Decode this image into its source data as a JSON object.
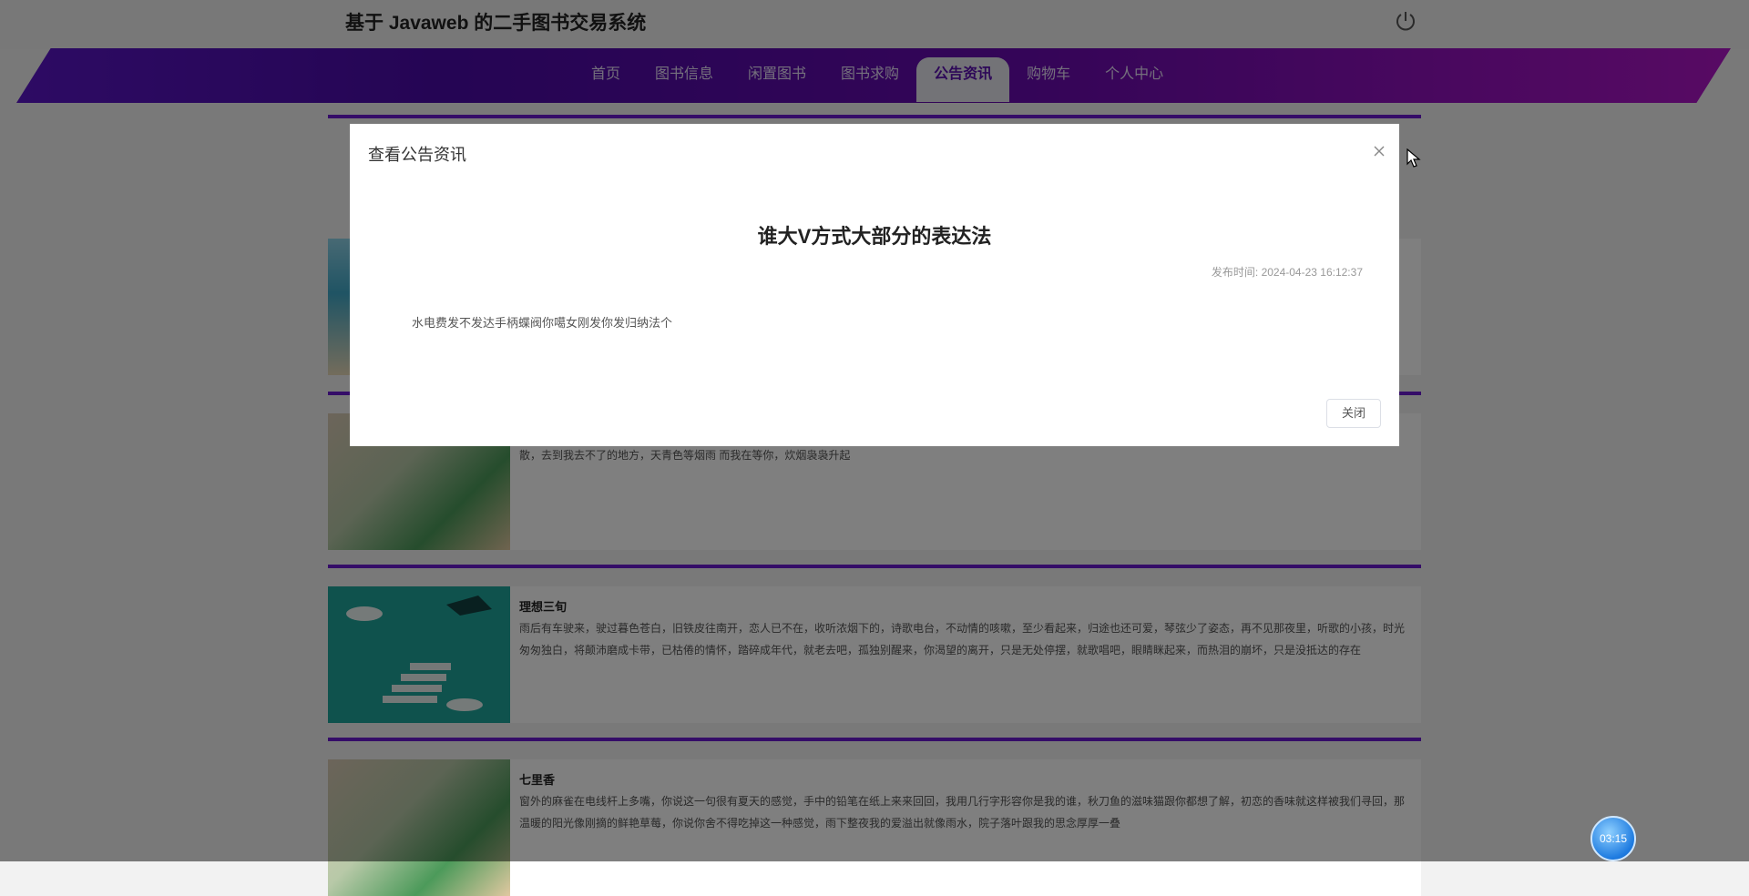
{
  "header": {
    "site_title": "基于 Javaweb 的二手图书交易系统"
  },
  "nav": {
    "items": [
      {
        "label": "首页"
      },
      {
        "label": "图书信息"
      },
      {
        "label": "闲置图书"
      },
      {
        "label": "图书求购"
      },
      {
        "label": "公告资讯"
      },
      {
        "label": "购物车"
      },
      {
        "label": "个人中心"
      }
    ],
    "active": "公告资讯"
  },
  "cards": [
    {
      "title": "",
      "text": ""
    },
    {
      "title": "",
      "text": "素眩勾勒出青花笔锋浓转淡，瓶身描绘的牡丹一如你初妆，冉冉檀香透过窗心事我了然，宣上走笔至此搁一半，釉色渲染仕女图韵味被私藏，而你嫣然的一笑如含苞待放，你的美谈飘散，去到我去不了的地方，天青色等烟雨 而我在等你，炊烟袅袅升起"
    },
    {
      "title": "理想三旬",
      "text": "雨后有车驶来，驶过暮色苍白，旧铁皮往南开，恋人已不在，收听浓烟下的，诗歌电台，不动情的咳嗽，至少看起来，归途也还可爱，琴弦少了姿态，再不见那夜里，听歌的小孩，时光匆匆独白，将颠沛磨成卡带，已枯倦的情怀，踏碎成年代，就老去吧，孤独别醒来，你渴望的离开，只是无处停摆，就歌唱吧，眼睛眯起来，而热泪的崩坏，只是没抵达的存在"
    },
    {
      "title": "七里香",
      "text": "窗外的麻雀在电线杆上多嘴，你说这一句很有夏天的感觉，手中的铅笔在纸上来来回回，我用几行字形容你是我的谁，秋刀鱼的滋味猫跟你都想了解，初恋的香味就这样被我们寻回，那温暖的阳光像刚摘的鲜艳草莓，你说你舍不得吃掉这一种感觉，雨下整夜我的爱溢出就像雨水，院子落叶跟我的思念厚厚一叠"
    }
  ],
  "modal": {
    "header": "查看公告资讯",
    "article_title": "谁大V方式大部分的表达法",
    "pub_label": "发布时间:",
    "pub_time": "2024-04-23 16:12:37",
    "body": "水电费发不发达手柄蝶阀你噶女刚发你发归纳法个",
    "close_button": "关闭"
  },
  "timer": "03:15",
  "colors": {
    "accent": "#6a1bd0",
    "nav_gradient_start": "#5b16c8",
    "nav_gradient_end": "#b015c8",
    "overlay": "rgba(0,0,0,0.5)",
    "timer_blue": "#1e7be0"
  },
  "icons": {
    "power": "power-icon",
    "close": "close-icon",
    "cursor": "mouse-cursor-icon"
  }
}
